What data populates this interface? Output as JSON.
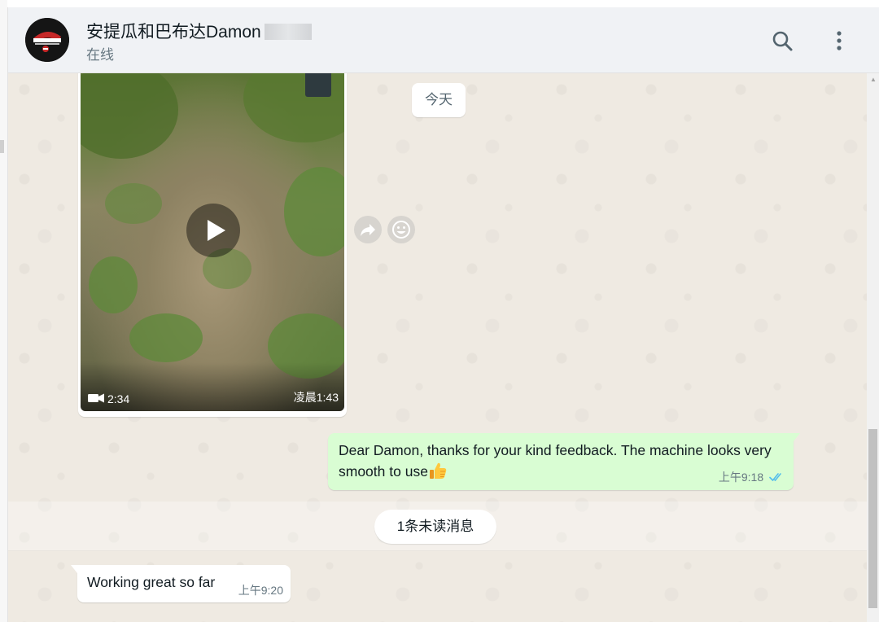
{
  "header": {
    "contact_name": "安提瓜和巴布达Damon",
    "status": "在线",
    "avatar_icon": "brand-logo-avatar",
    "search_icon": "search-icon",
    "menu_icon": "kebab-menu-icon"
  },
  "chat": {
    "date_divider": "今天",
    "video_message": {
      "duration": "2:34",
      "time": "凌晨1:43",
      "icon": "video-camera-icon"
    },
    "actions": {
      "forward_icon": "forward-icon",
      "reaction_icon": "emoji-icon"
    },
    "outgoing": {
      "text": "Dear Damon, thanks for your kind feedback. The machine looks very smooth to use",
      "emoji_icon": "thumbs-up-icon",
      "time": "上午9:18",
      "status_icon": "double-check-icon",
      "status_color": "#53bdeb"
    },
    "unread_divider": "1条未读消息",
    "incoming": {
      "text": "Working great so far",
      "time": "上午9:20"
    }
  },
  "colors": {
    "header_bg": "#f0f2f5",
    "chat_bg": "#efeae2",
    "outgoing_bubble": "#d9fdd3",
    "incoming_bubble": "#ffffff",
    "read_ticks": "#53bdeb"
  }
}
